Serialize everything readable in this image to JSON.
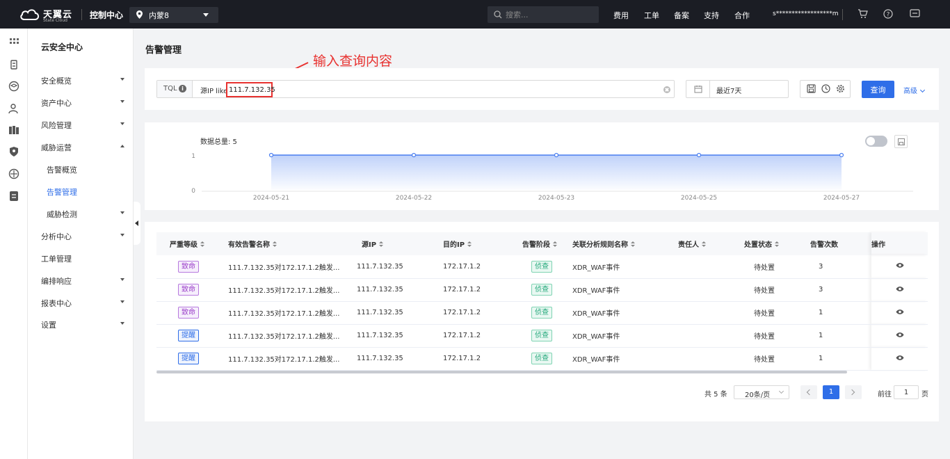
{
  "topbar": {
    "brand": "天翼云",
    "brand_sub": "State Cloud",
    "console": "控制中心",
    "region": "内蒙8",
    "search_placeholder": "搜索...",
    "links": [
      "费用",
      "工单",
      "备案",
      "支持",
      "合作"
    ],
    "account": "s******************m"
  },
  "sidebar": {
    "title": "云安全中心",
    "items": [
      {
        "label": "安全概览"
      },
      {
        "label": "资产中心"
      },
      {
        "label": "风险管理"
      },
      {
        "label": "威胁运营"
      },
      {
        "label": "分析中心"
      },
      {
        "label": "工单管理"
      },
      {
        "label": "编排响应"
      },
      {
        "label": "报表中心"
      },
      {
        "label": "设置"
      }
    ],
    "sub": [
      "告警概览",
      "告警管理",
      "威胁检测"
    ]
  },
  "page": {
    "title": "告警管理",
    "annotation": "输入查询内容"
  },
  "query": {
    "tql_label": "TQL",
    "prefix": "源IP like",
    "value": "111.7.132.35",
    "date_range": "最近7天",
    "query_btn": "查询",
    "advanced": "高级"
  },
  "chart_data": {
    "type": "area",
    "title": "数据总量: 5",
    "x": [
      "2024-05-21",
      "2024-05-22",
      "2024-05-23",
      "2024-05-25",
      "2024-05-27"
    ],
    "values": [
      1,
      1,
      1,
      1,
      1
    ],
    "yticks": [
      "1",
      "0"
    ],
    "ylim": [
      0,
      1
    ],
    "color": "#4a7ef0"
  },
  "table": {
    "headers": [
      "严重等级",
      "有效告警名称",
      "源IP",
      "目的IP",
      "告警阶段",
      "关联分析规则名称",
      "责任人",
      "处置状态",
      "告警次数",
      "操作"
    ],
    "rows": [
      {
        "level": "致命",
        "name": "111.7.132.35对172.17.1.2触发...",
        "src": "111.7.132.35",
        "dst": "172.17.1.2",
        "stage": "侦查",
        "rule": "XDR_WAF事件",
        "owner": "",
        "status": "待处置",
        "count": "3"
      },
      {
        "level": "致命",
        "name": "111.7.132.35对172.17.1.2触发...",
        "src": "111.7.132.35",
        "dst": "172.17.1.2",
        "stage": "侦查",
        "rule": "XDR_WAF事件",
        "owner": "",
        "status": "待处置",
        "count": "3"
      },
      {
        "level": "致命",
        "name": "111.7.132.35对172.17.1.2触发...",
        "src": "111.7.132.35",
        "dst": "172.17.1.2",
        "stage": "侦查",
        "rule": "XDR_WAF事件",
        "owner": "",
        "status": "待处置",
        "count": "1"
      },
      {
        "level": "提醒",
        "name": "111.7.132.35对172.17.1.2触发...",
        "src": "111.7.132.35",
        "dst": "172.17.1.2",
        "stage": "侦查",
        "rule": "XDR_WAF事件",
        "owner": "",
        "status": "待处置",
        "count": "1"
      },
      {
        "level": "提醒",
        "name": "111.7.132.35对172.17.1.2触发...",
        "src": "111.7.132.35",
        "dst": "172.17.1.2",
        "stage": "侦查",
        "rule": "XDR_WAF事件",
        "owner": "",
        "status": "待处置",
        "count": "1"
      }
    ]
  },
  "pager": {
    "total": "共 5 条",
    "size": "20条/页",
    "current": "1",
    "goto_prefix": "前往",
    "goto_value": "1",
    "goto_suffix": "页"
  },
  "colors": {
    "accent": "#2f6ee8",
    "annotation": "#e8312f",
    "topbar": "#1b1d24"
  }
}
